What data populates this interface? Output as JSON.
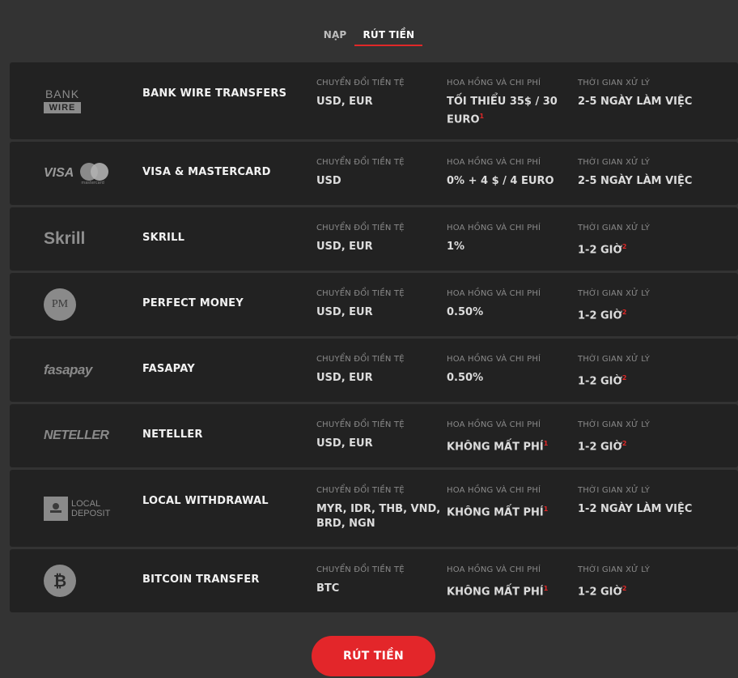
{
  "tabs": [
    {
      "label": "NẠP",
      "active": false
    },
    {
      "label": "RÚT TIỀN",
      "active": true
    }
  ],
  "labels": {
    "currency": "CHUYỂN ĐỔI TIỀN TỆ",
    "fee": "HOA HỒNG VÀ CHI PHÍ",
    "time": "THỜI GIAN XỬ LÝ"
  },
  "methods": [
    {
      "name": "BANK WIRE TRANSFERS",
      "logo": "bank-wire-logo",
      "logo_text": [
        "BANK",
        "WIRE"
      ],
      "currency": "USD, EUR",
      "fee": "TỐI THIỂU 35$ / 30 EURO",
      "fee_note": "1",
      "time": "2-5 NGÀY LÀM VIỆC",
      "time_note": ""
    },
    {
      "name": "VISA & MASTERCARD",
      "logo": "visa-mastercard-logo",
      "logo_text": [
        "VISA",
        "mastercard"
      ],
      "currency": "USD",
      "fee": "0% + 4 $ / 4 EURO",
      "fee_note": "",
      "time": "2-5 NGÀY LÀM VIỆC",
      "time_note": ""
    },
    {
      "name": "SKRILL",
      "logo": "skrill-logo",
      "logo_text": [
        "Skrill"
      ],
      "currency": "USD, EUR",
      "fee": "1%",
      "fee_note": "",
      "time": "1-2 GIỜ",
      "time_note": "2"
    },
    {
      "name": "PERFECT MONEY",
      "logo": "perfect-money-logo",
      "logo_text": [
        "PM"
      ],
      "currency": "USD, EUR",
      "fee": "0.50%",
      "fee_note": "",
      "time": "1-2 GIỜ",
      "time_note": "2"
    },
    {
      "name": "FASAPAY",
      "logo": "fasapay-logo",
      "logo_text": [
        "fasapay"
      ],
      "currency": "USD, EUR",
      "fee": "0.50%",
      "fee_note": "",
      "time": "1-2 GIỜ",
      "time_note": "2"
    },
    {
      "name": "NETELLER",
      "logo": "neteller-logo",
      "logo_text": [
        "NETELLER"
      ],
      "currency": "USD, EUR",
      "fee": "KHÔNG MẤT PHÍ",
      "fee_note": "1",
      "time": "1-2 GIỜ",
      "time_note": "2"
    },
    {
      "name": "LOCAL WITHDRAWAL",
      "logo": "local-deposit-logo",
      "logo_text": [
        "LOCAL",
        "DEPOSIT"
      ],
      "currency": "MYR, IDR, THB, VND, BRD, NGN",
      "fee": "KHÔNG MẤT PHÍ",
      "fee_note": "1",
      "time": "1-2 NGÀY LÀM VIỆC",
      "time_note": ""
    },
    {
      "name": "BITCOIN TRANSFER",
      "logo": "bitcoin-logo",
      "logo_text": [
        "₿"
      ],
      "currency": "BTC",
      "fee": "KHÔNG MẤT PHÍ",
      "fee_note": "1",
      "time": "1-2 GIỜ",
      "time_note": "2"
    }
  ],
  "button": {
    "label": "RÚT TIỀN"
  }
}
